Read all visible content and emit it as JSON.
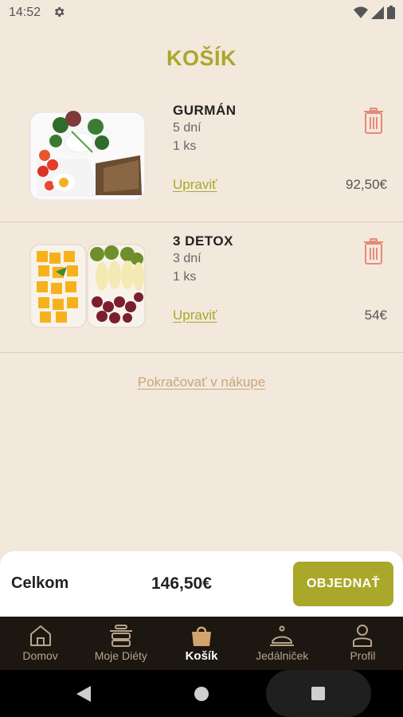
{
  "status": {
    "time": "14:52"
  },
  "page": {
    "title": "KOŠÍK"
  },
  "cart": {
    "items": [
      {
        "name": "GURMÁN",
        "days": "5 dní",
        "qty": "1 ks",
        "edit_label": "Upraviť",
        "price": "92,50€"
      },
      {
        "name": "3 DETOX",
        "days": "3 dní",
        "qty": "1 ks",
        "edit_label": "Upraviť",
        "price": "54€"
      }
    ],
    "continue_label": "Pokračovať v nákupe"
  },
  "summary": {
    "total_label": "Celkom",
    "total_value": "146,50€",
    "order_label": "OBJEDNAŤ"
  },
  "nav": {
    "items": [
      {
        "label": "Domov",
        "icon": "home-icon"
      },
      {
        "label": "Moje Diéty",
        "icon": "pot-icon"
      },
      {
        "label": "Košík",
        "icon": "basket-icon",
        "active": true
      },
      {
        "label": "Jedálniček",
        "icon": "cloche-icon"
      },
      {
        "label": "Profil",
        "icon": "user-icon"
      }
    ]
  },
  "colors": {
    "accent": "#a9a82a",
    "background": "#f3e8dc",
    "trash": "#e58b78",
    "nav_bg": "#1c1711"
  }
}
